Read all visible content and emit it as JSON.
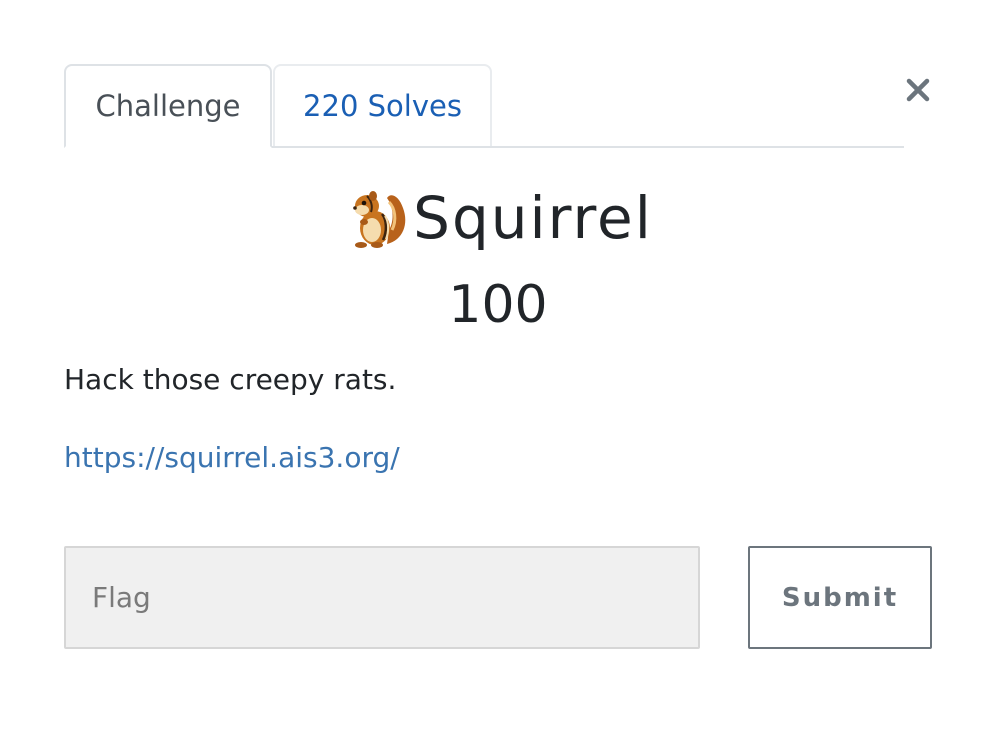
{
  "tabs": [
    {
      "label": "Challenge",
      "active": true
    },
    {
      "label": "220 Solves",
      "active": false
    }
  ],
  "close": {
    "icon": "close-icon",
    "glyph": "×"
  },
  "challenge": {
    "emoji_icon": "chipmunk-emoji-icon",
    "name": "Squirrel",
    "points": "100",
    "description": "Hack those creepy rats.",
    "link": "https://squirrel.ais3.org/"
  },
  "form": {
    "flag_placeholder": "Flag",
    "flag_value": "",
    "submit_label": "Submit"
  },
  "colors": {
    "link": "#3a74b0",
    "tab_link": "#1a5fb4",
    "input_bg": "#f0f0f0",
    "button_border": "#6c757d"
  }
}
